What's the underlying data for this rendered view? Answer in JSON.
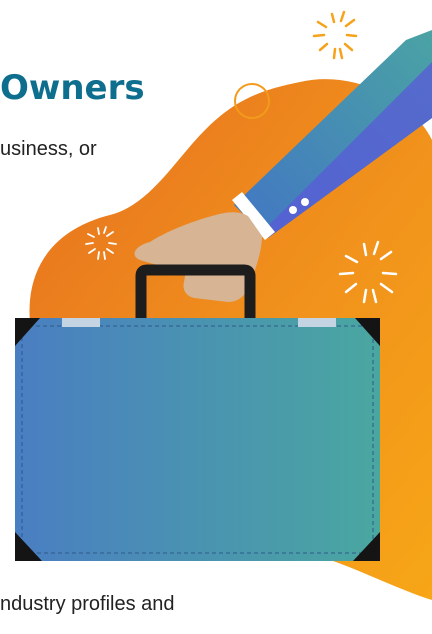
{
  "heading": {
    "text": "Owners",
    "color": "#0e6e8e"
  },
  "body_text": {
    "line_1": "usiness, or",
    "line_2": "ndustry profiles and"
  },
  "illustration": {
    "description_icon": "briefcase-in-hand-icon",
    "blob_colors": [
      "#f39a1c",
      "#e66f1f"
    ],
    "sleeve_color": "#3f7fc0",
    "case_gradient": [
      "#4a7fc0",
      "#4aa5a2"
    ]
  }
}
